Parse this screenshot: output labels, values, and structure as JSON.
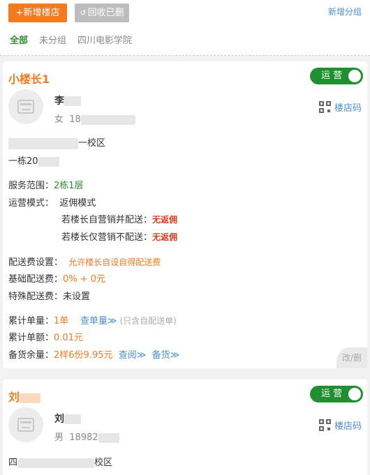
{
  "toolbar": {
    "add_label": "+新增楼店",
    "recycle_label": "回收已删",
    "recycle_icon": "refresh-icon",
    "new_group_label": "新增分组"
  },
  "tabs": [
    "全部",
    "未分组",
    "四川电影学院"
  ],
  "active_tab": "全部",
  "colors": {
    "accent": "#f47a20",
    "green": "#1f8f2f",
    "link": "#4a8fd6"
  },
  "card1": {
    "store_name": "小楼长1",
    "status": "运 营",
    "owner_name": "李",
    "owner_gender": "女",
    "owner_phone": "18",
    "qr_label": "楼店码",
    "campus": "一校区",
    "address": "一栋20",
    "service_range_label": "服务范围：",
    "service_range_value": "2栋1层",
    "mode_label": "运营模式：",
    "mode_value": "返佣模式",
    "mode_line1_label": "若楼长自营销并配送：",
    "mode_line1_value": "无返佣",
    "mode_line2_label": "若楼长仅营销不配送：",
    "mode_line2_value": "无返佣",
    "delivery_setting_label": "配送费设置：",
    "delivery_setting_value": "允许楼长自设自得配送费",
    "base_fee_label": "基础配送费：",
    "base_fee_value": "0% + 0元",
    "special_fee_label": "特殊配送费：",
    "special_fee_value": "未设置",
    "orders_label": "累计单量：",
    "orders_value": "1单",
    "orders_link": "查单量≫",
    "orders_note": "(只含自配送单)",
    "amount_label": "累计单额：",
    "amount_value": "0.01元",
    "stock_label": "备货余量：",
    "stock_value": "2样6份9.95元",
    "stock_link1": "查阅≫",
    "stock_link2": "备货≫",
    "edit_label": "改/删"
  },
  "card2": {
    "store_name": "刘",
    "status": "运 营",
    "owner_name": "刘",
    "owner_gender": "男",
    "owner_phone": "18982",
    "qr_label": "楼店码",
    "address_start": "四",
    "address_end": "校区"
  }
}
